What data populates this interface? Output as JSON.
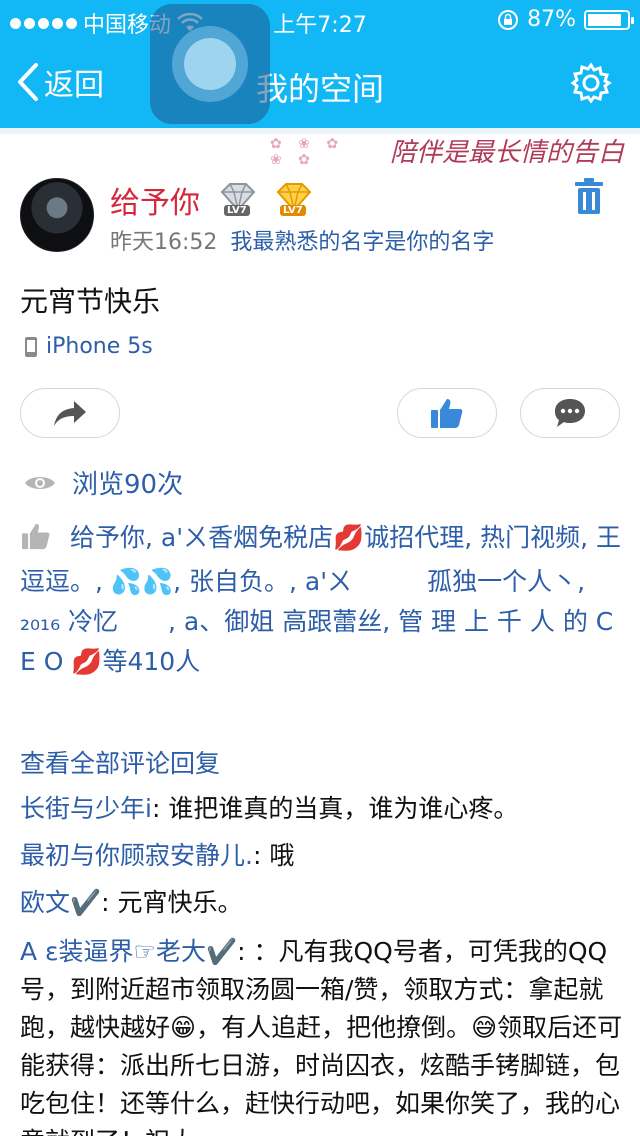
{
  "status_bar": {
    "carrier": "中国移动",
    "time": "上午7:27",
    "battery": "87%",
    "battery_level": 0.87
  },
  "nav": {
    "back_label": "返回",
    "title": "我的空间",
    "settings_icon": "gear-icon"
  },
  "banner": {
    "slogan": "陪伴是最长情的告白"
  },
  "post": {
    "author": "给予你",
    "badges": [
      "LV7",
      "LV7"
    ],
    "timestamp": "昨天16:52",
    "signature": "我最熟悉的名字是你的名字",
    "text": "元宵节快乐",
    "device": "iPhone 5s"
  },
  "views": "浏览90次",
  "likes": {
    "text": "给予你, a'ㄨ香烟免税店💋诚招代理, 热门视频, 王逗逗。, 💦💦, 张自负。, a'ㄨ　　　孤独一个人丶, ₂₀₁₆ 冷忆　　, a、御姐 高跟蕾丝, 管 理 上 千 人 的 C E O 💋等410人"
  },
  "comments": {
    "view_all": "查看全部评论回复",
    "items": [
      {
        "author": "长街与少年i",
        "text": ": 谁把谁真的当真，谁为谁心疼。"
      },
      {
        "author": "最初与你顾寂安静儿.",
        "text": ": 哦"
      },
      {
        "author": "欧文✔️",
        "text": ": 元宵快乐。"
      },
      {
        "author": "A ε装逼界☞老大✔️",
        "text": ": ：凡有我QQ号者，可凭我的QQ号，到附近超市领取汤圆一箱/赞，领取方式：拿起就跑，越快越好😁，有人追赶，把他撩倒。😅领取后还可能获得：派出所七日游，时尚囚衣，炫酷手铐脚链，包吃包住！还等什么，赶快行动吧，如果你笑了，我的心意就到了！祝大"
      }
    ]
  },
  "colors": {
    "header_blue": "#12b7f5",
    "link_blue": "#2d5ea8",
    "author_red": "#d6263b"
  }
}
